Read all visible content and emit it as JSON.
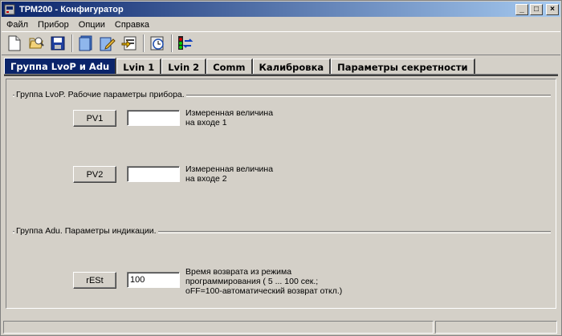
{
  "window": {
    "title": "ТРМ200 - Конфигуратор",
    "controls": {
      "minimize": "_",
      "maximize": "□",
      "close": "×"
    }
  },
  "menu": {
    "items": [
      {
        "label": "Файл"
      },
      {
        "label": "Прибор"
      },
      {
        "label": "Опции"
      },
      {
        "label": "Справка"
      }
    ]
  },
  "toolbar": {
    "icons": [
      "new-file-icon",
      "open-folder-icon",
      "save-icon",
      "read-device-icon",
      "write-device-icon",
      "export-icon",
      "clock-icon",
      "traffic-light-icon"
    ]
  },
  "tabs": [
    {
      "label": "Группа LvoP и Adu",
      "active": true
    },
    {
      "label": "Lvin 1",
      "active": false
    },
    {
      "label": "Lvin 2",
      "active": false
    },
    {
      "label": "Comm",
      "active": false
    },
    {
      "label": "Калибровка",
      "active": false
    },
    {
      "label": "Параметры секретности",
      "active": false
    }
  ],
  "groups": {
    "lvop": {
      "title": "Группа LvoP. Рабочие параметры прибора.",
      "pv1": {
        "button": "PV1",
        "value": "",
        "description": "Измеренная величина\nна входе 1"
      },
      "pv2": {
        "button": "PV2",
        "value": "",
        "description": "Измеренная величина\nна входе 2"
      }
    },
    "adu": {
      "title": "Группа Adu. Параметры индикации.",
      "rest": {
        "button": "rESt",
        "value": "100",
        "description": "Время возврата из режима\nпрограммирования ( 5 ... 100 сек.;\noFF=100-автоматический возврат откл.)"
      }
    }
  },
  "colors": {
    "face": "#d4d0c8",
    "title_start": "#0a246a",
    "title_end": "#a6caf0",
    "active_tab": "#0a246a"
  }
}
